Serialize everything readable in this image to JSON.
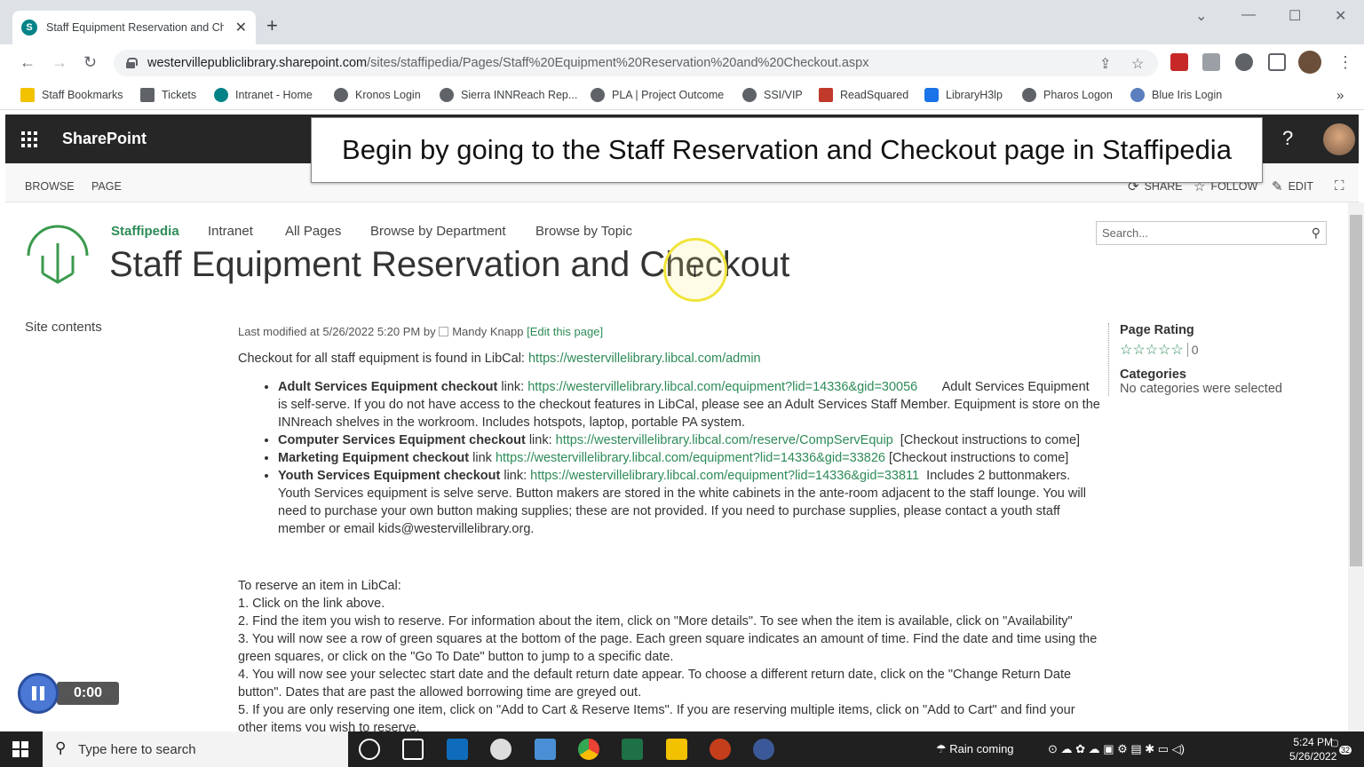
{
  "browser": {
    "tab_title": "Staff Equipment Reservation and Ch",
    "tab_favicon": "S",
    "url_host": "westervillepubliclibrary.sharepoint.com",
    "url_path": "/sites/staffipedia/Pages/Staff%20Equipment%20Reservation%20and%20Checkout.aspx"
  },
  "bookmarks": [
    "Staff Bookmarks",
    "Tickets",
    "Intranet - Home",
    "Kronos Login",
    "Sierra INNReach Rep...",
    "PLA | Project Outcome",
    "SSI/VIP",
    "ReadSquared",
    "LibraryH3lp",
    "Pharos Logon",
    "Blue Iris Login"
  ],
  "suite": {
    "brand": "SharePoint",
    "help": "?"
  },
  "ribbon": {
    "tabs": [
      "BROWSE",
      "PAGE"
    ],
    "actions": [
      "SHARE",
      "FOLLOW",
      "EDIT"
    ]
  },
  "caption": "Begin by going to the Staff Reservation and Checkout page in Staffipedia",
  "site_nav": [
    "Staffipedia",
    "Intranet",
    "All Pages",
    "Browse by Department",
    "Browse by Topic"
  ],
  "search_placeholder": "Search...",
  "page_title": "Staff Equipment Reservation and Checkout",
  "left_nav": {
    "site_contents": "Site contents"
  },
  "meta": {
    "prefix": "Last modified at 5/26/2022 5:20 PM by",
    "author": "Mandy Knapp",
    "edit_link": "[Edit this page]"
  },
  "intro": {
    "text": "Checkout for all staff equipment is found in LibCal: ",
    "link": "https://westervillelibrary.libcal.com/admin"
  },
  "items": [
    {
      "bold": "Adult Services Equipment checkout",
      "mid": " link: ",
      "link": "https://westervillelibrary.libcal.com/equipment?lid=14336&gid=30056",
      "after": "       Adult Services Equipment is self-serve. If you do not have access to the checkout features in LibCal, please see an Adult Services Staff Member. Equipment is store on the INNreach shelves in the workroom. Includes hotspots, laptop, portable PA system."
    },
    {
      "bold": "Computer Services Equipment checkout",
      "mid": " link: ",
      "link": "https://westervillelibrary.libcal.com/reserve/CompServEquip",
      "after": "  [Checkout instructions to come]"
    },
    {
      "bold": "Marketing Equipment checkout",
      "mid": " link ",
      "link": "https://westervillelibrary.libcal.com/equipment?lid=14336&gid=33826",
      "after": " [Checkout instructions to come]"
    },
    {
      "bold": "Youth Services Equipment checkout",
      "mid": " link: ",
      "link": "https://westervillelibrary.libcal.com/equipment?lid=14336&gid=33811",
      "after": "  Includes 2 buttonmakers. Youth Services equipment is selve serve. Button makers are stored in the white cabinets in the ante-room adjacent to the staff lounge. You will need to purchase your own button making supplies; these are not provided. If you need to purchase supplies, please contact a youth staff member or email kids@westervillelibrary.org."
    }
  ],
  "steps": [
    "To reserve an item in LibCal:",
    "1. Click on the link above.",
    "2. Find the item you wish to reserve. For information about the item, click on \"More details\". To see when the item is available, click on \"Availability\"",
    "3. You will now see a row of green squares at the bottom of the page. Each green square indicates an amount of time. Find the date and time using the green squares, or click on the \"Go To Date\" button to jump to a specific date.",
    "4. You will now see your selectec start date and the default return date appear. To choose a different return date, click on the \"Change Return Date button\". Dates that are past the allowed borrowing time are greyed out.",
    "5. If you are only reserving one item, click on \"Add to Cart & Reserve Items\". If you are reserving multiple items, click on \"Add to Cart\" and find your other items you wish to reserve."
  ],
  "right": {
    "rating_heading": "Page Rating",
    "rating_count": "0",
    "categories_heading": "Categories",
    "categories_text": "No categories were selected"
  },
  "recorder": {
    "time": "0:00"
  },
  "taskbar": {
    "search_placeholder": "Type here to search",
    "weather": "Rain coming",
    "time": "5:24 PM",
    "date": "5/26/2022",
    "notifications": "32"
  }
}
